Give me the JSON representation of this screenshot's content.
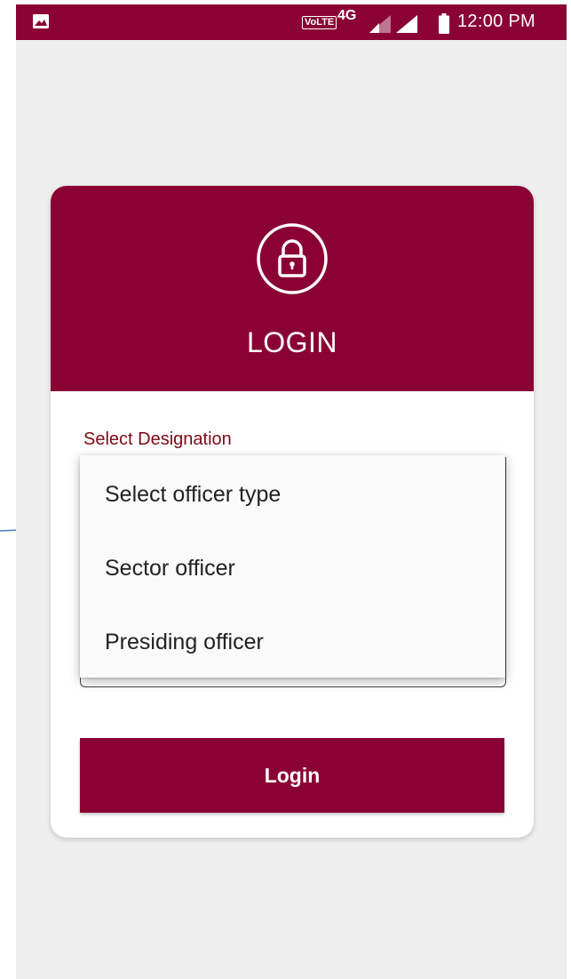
{
  "status_bar": {
    "network_badge": "VoLTE",
    "network_type": "4G",
    "time": "12:00 PM",
    "icons": [
      "gallery-icon",
      "signal-icon",
      "signal-icon",
      "battery-icon"
    ]
  },
  "header": {
    "icon": "lock-icon",
    "title": "LOGIN"
  },
  "form": {
    "designation_label": "Select Designation",
    "dropdown_options": [
      "Select officer type",
      "Sector officer",
      "Presiding officer"
    ],
    "login_button": "Login"
  },
  "colors": {
    "primary": "#8a0233",
    "background": "#eeeeee",
    "label": "#7a0a16",
    "arrow": "#4a7dbb"
  }
}
